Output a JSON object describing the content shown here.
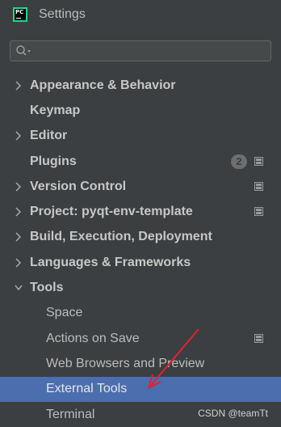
{
  "window": {
    "title": "Settings",
    "app_icon": "pycharm-icon"
  },
  "search": {
    "placeholder": "",
    "value": "",
    "icon": "search-icon"
  },
  "tree": [
    {
      "label": "Appearance & Behavior",
      "level": 0,
      "expandable": true,
      "expanded": false
    },
    {
      "label": "Keymap",
      "level": 0,
      "expandable": false
    },
    {
      "label": "Editor",
      "level": 0,
      "expandable": true,
      "expanded": false
    },
    {
      "label": "Plugins",
      "level": 0,
      "expandable": false,
      "badge": "2",
      "project_icon": true
    },
    {
      "label": "Version Control",
      "level": 0,
      "expandable": true,
      "expanded": false,
      "project_icon": true
    },
    {
      "label": "Project: pyqt-env-template",
      "level": 0,
      "expandable": true,
      "expanded": false,
      "project_icon": true
    },
    {
      "label": "Build, Execution, Deployment",
      "level": 0,
      "expandable": true,
      "expanded": false
    },
    {
      "label": "Languages & Frameworks",
      "level": 0,
      "expandable": true,
      "expanded": false
    },
    {
      "label": "Tools",
      "level": 0,
      "expandable": true,
      "expanded": true
    },
    {
      "label": "Space",
      "level": 1
    },
    {
      "label": "Actions on Save",
      "level": 1,
      "project_icon": true
    },
    {
      "label": "Web Browsers and Preview",
      "level": 1
    },
    {
      "label": "External Tools",
      "level": 1,
      "selected": true
    },
    {
      "label": "Terminal",
      "level": 1
    }
  ],
  "watermark": "CSDN @teamTt",
  "colors": {
    "background": "#3c3f41",
    "selection": "#4b6eaf",
    "annotation_arrow": "#e8202a",
    "badge": "#6e6e6e"
  }
}
